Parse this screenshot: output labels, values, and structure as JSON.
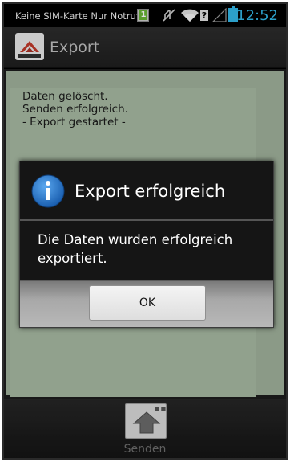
{
  "status_bar": {
    "carrier": "Keine SIM-Karte Nur Notrufe",
    "sim_badge": "1",
    "time": "12:52",
    "icons": [
      "sim-notification-icon",
      "mute-icon",
      "wifi-icon",
      "signal-icon",
      "battery-icon"
    ],
    "time_color": "#33b5e5"
  },
  "action_bar": {
    "title": "Export",
    "app_icon": "app-logo-icon"
  },
  "log": {
    "lines": [
      "Daten gelöscht.",
      "Senden erfolgreich.",
      "- Export gestartet -"
    ]
  },
  "dialog": {
    "title": "Export erfolgreich",
    "message": "Die Daten wurden erfolgreich exportiert.",
    "ok_label": "OK",
    "icon": "info-icon",
    "icon_color": "#1f6fc4"
  },
  "bottom_bar": {
    "send_label": "Senden",
    "send_icon": "upload-arrow-icon"
  }
}
